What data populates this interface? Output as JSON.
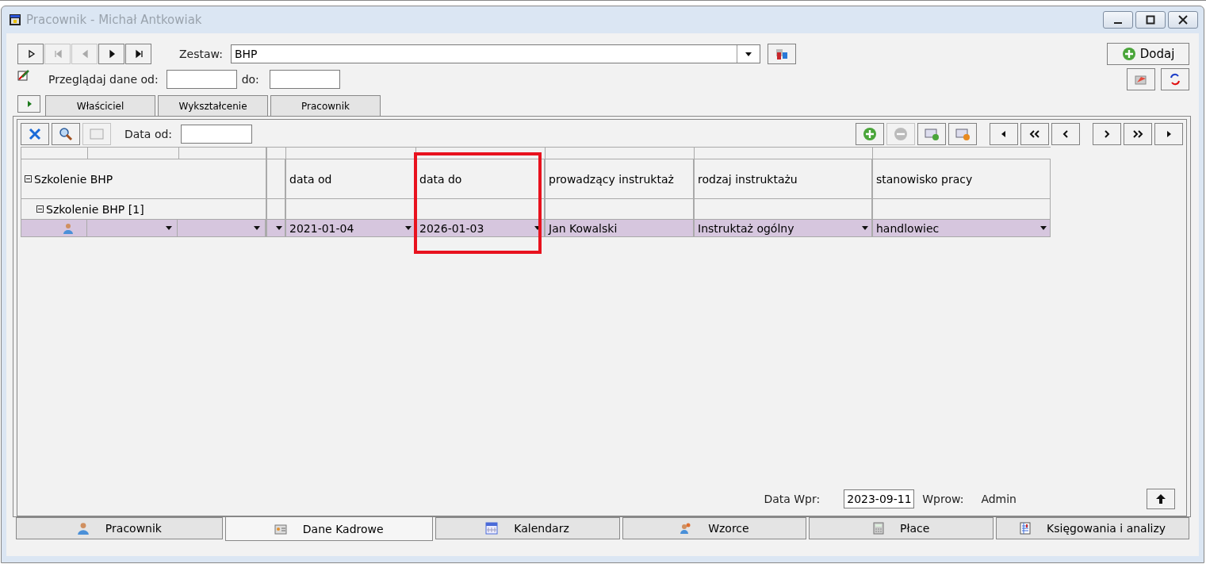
{
  "window": {
    "title": "Pracownik - Michał Antkowiak"
  },
  "nav_buttons": [
    {
      "kind": "new",
      "disabled": false
    },
    {
      "kind": "first",
      "disabled": true
    },
    {
      "kind": "prev",
      "disabled": true
    },
    {
      "kind": "next",
      "disabled": false
    },
    {
      "kind": "last",
      "disabled": false
    }
  ],
  "zestaw": {
    "label": "Zestaw:",
    "value": "BHP"
  },
  "add_button": {
    "label": "Dodaj"
  },
  "browse": {
    "label": "Przeglądaj dane od:",
    "to_label": "do:"
  },
  "top_tabs": [
    {
      "label": "Właściciel",
      "selected": false
    },
    {
      "label": "Wykształcenie",
      "selected": false
    },
    {
      "label": "Pracownik",
      "selected": false
    }
  ],
  "grid_toolbar": {
    "date_label": "Data od:",
    "remove_disabled": true,
    "calc_disabled": true
  },
  "tree": {
    "label": "Szkolenie BHP",
    "expanded": true,
    "children": [
      {
        "label": "Szkolenie BHP [1]",
        "expanded": true
      }
    ]
  },
  "columns": [
    {
      "header": "data od",
      "value": "2021-01-04",
      "dropdown": true,
      "highlighted": false
    },
    {
      "header": "data do",
      "value": "2026-01-03",
      "dropdown": true,
      "highlighted": true
    },
    {
      "header": "prowadzący instruktaż",
      "value": "Jan Kowalski",
      "dropdown": false,
      "highlighted": false
    },
    {
      "header": "rodzaj instruktażu",
      "value": "Instruktaż ogólny",
      "dropdown": true,
      "highlighted": false
    },
    {
      "header": "stanowisko pracy",
      "value": "handlowiec",
      "dropdown": true,
      "highlighted": false
    }
  ],
  "footer": {
    "date_label": "Data Wpr:",
    "date_value": "2023-09-11",
    "author_label": "Wprow:",
    "author_value": "Admin"
  },
  "bottom_tabs": [
    {
      "label": "Pracownik",
      "kind": "person",
      "selected": false
    },
    {
      "label": "Dane Kadrowe",
      "kind": "card",
      "selected": true
    },
    {
      "label": "Kalendarz",
      "kind": "calendar",
      "selected": false
    },
    {
      "label": "Wzorce",
      "kind": "people",
      "selected": false
    },
    {
      "label": "Płace",
      "kind": "calculator",
      "selected": false
    },
    {
      "label": "Księgowania i analizy",
      "kind": "ledger",
      "selected": false
    }
  ]
}
